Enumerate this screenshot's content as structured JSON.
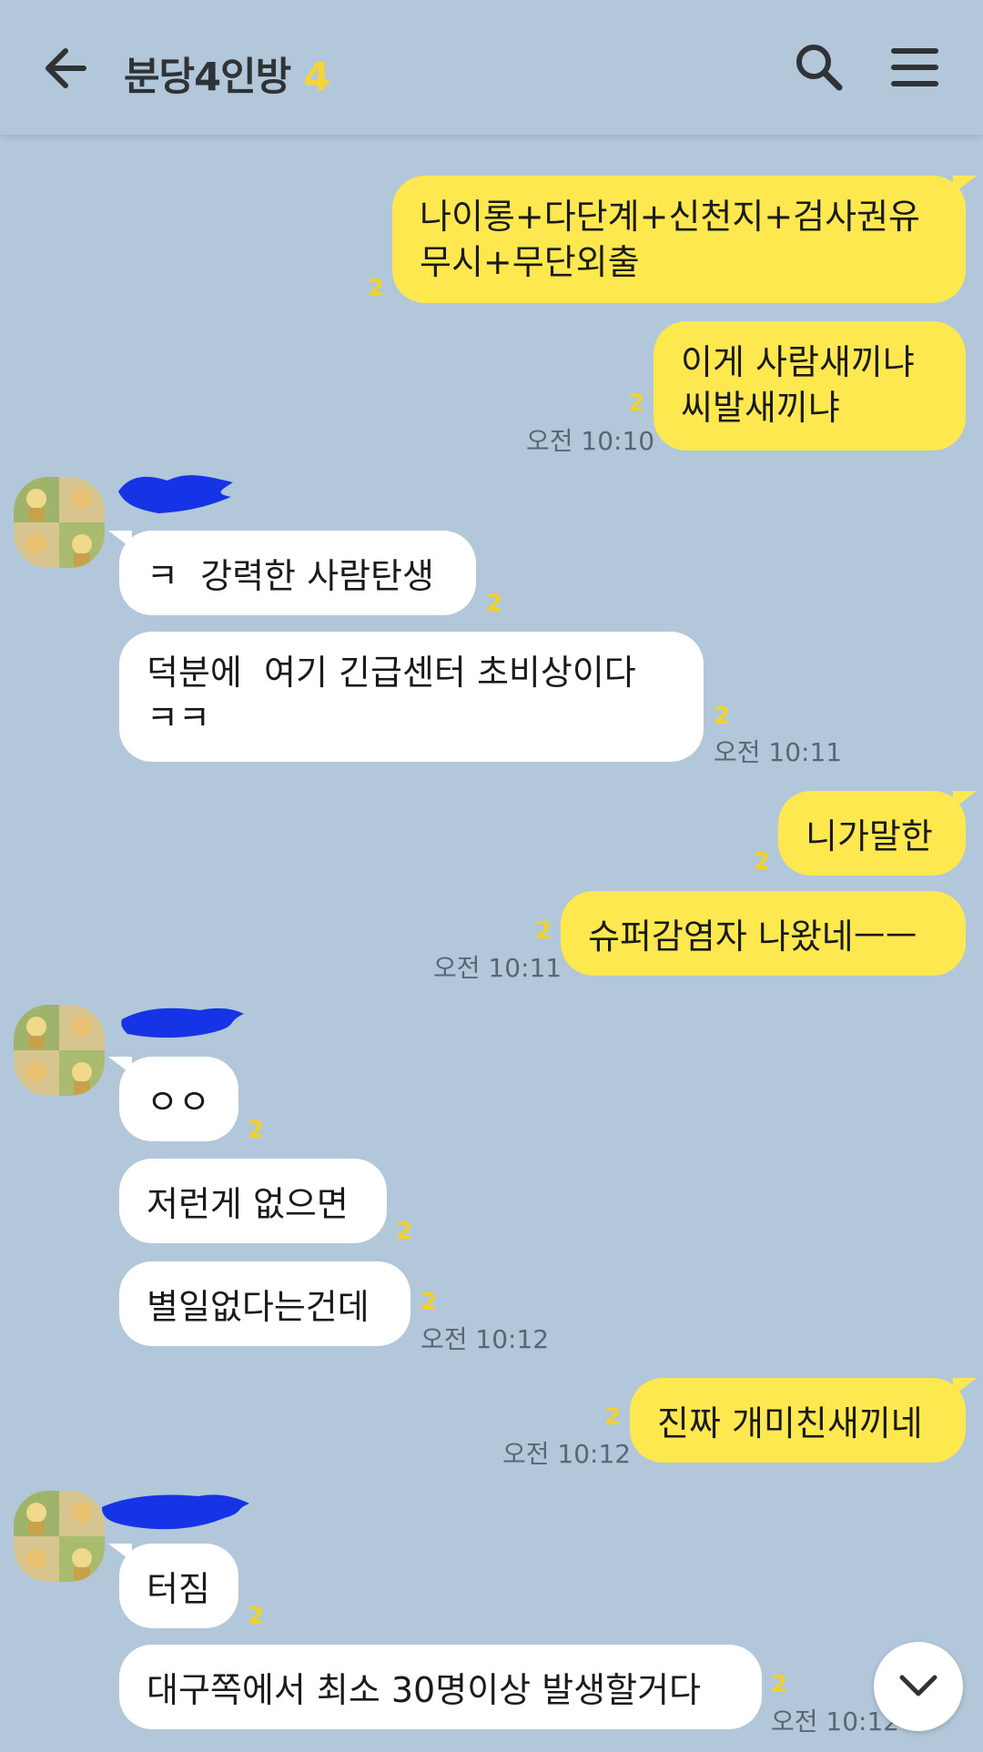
{
  "header": {
    "title": "분당4인방",
    "member_count": "4"
  },
  "messages": [
    {
      "sender": "me",
      "text": "나이롱+다단계+신천지+검사권유\n무시+무단외출",
      "unread": "2"
    },
    {
      "sender": "me",
      "text": "이게 사람새끼냐\n씨발새끼냐",
      "unread": "2",
      "time": "오전 10:10"
    },
    {
      "sender": "them",
      "text": "ㅋ  강력한 사람탄생",
      "unread": "2"
    },
    {
      "sender": "them",
      "text": "덕분에  여기 긴급센터 초비상이다\nㅋㅋ",
      "unread": "2",
      "time": "오전 10:11"
    },
    {
      "sender": "me",
      "text": "니가말한",
      "unread": "2"
    },
    {
      "sender": "me",
      "text": "슈퍼감염자 나왔네ㅡㅡ",
      "unread": "2",
      "time": "오전 10:11"
    },
    {
      "sender": "them",
      "text": "ㅇㅇ",
      "unread": "2"
    },
    {
      "sender": "them",
      "text": "저런게 없으면",
      "unread": "2"
    },
    {
      "sender": "them",
      "text": "별일없다는건데",
      "unread": "2",
      "time": "오전 10:12"
    },
    {
      "sender": "me",
      "text": "진짜 개미친새끼네",
      "unread": "2",
      "time": "오전 10:12"
    },
    {
      "sender": "them",
      "text": "터짐",
      "unread": "2"
    },
    {
      "sender": "them",
      "text": "대구쪽에서 최소 30명이상 발생할거다",
      "unread": "2",
      "time": "오전 10:12"
    }
  ],
  "icons": {
    "back": "arrow-left-icon",
    "search": "search-icon",
    "menu": "hamburger-menu-icon",
    "scroll_down": "chevron-down-icon"
  },
  "colors": {
    "background": "#b2c7da",
    "my_bubble": "#fee84f",
    "their_bubble": "#ffffff",
    "unread_count": "#f2d228",
    "redaction": "#1434e6"
  }
}
